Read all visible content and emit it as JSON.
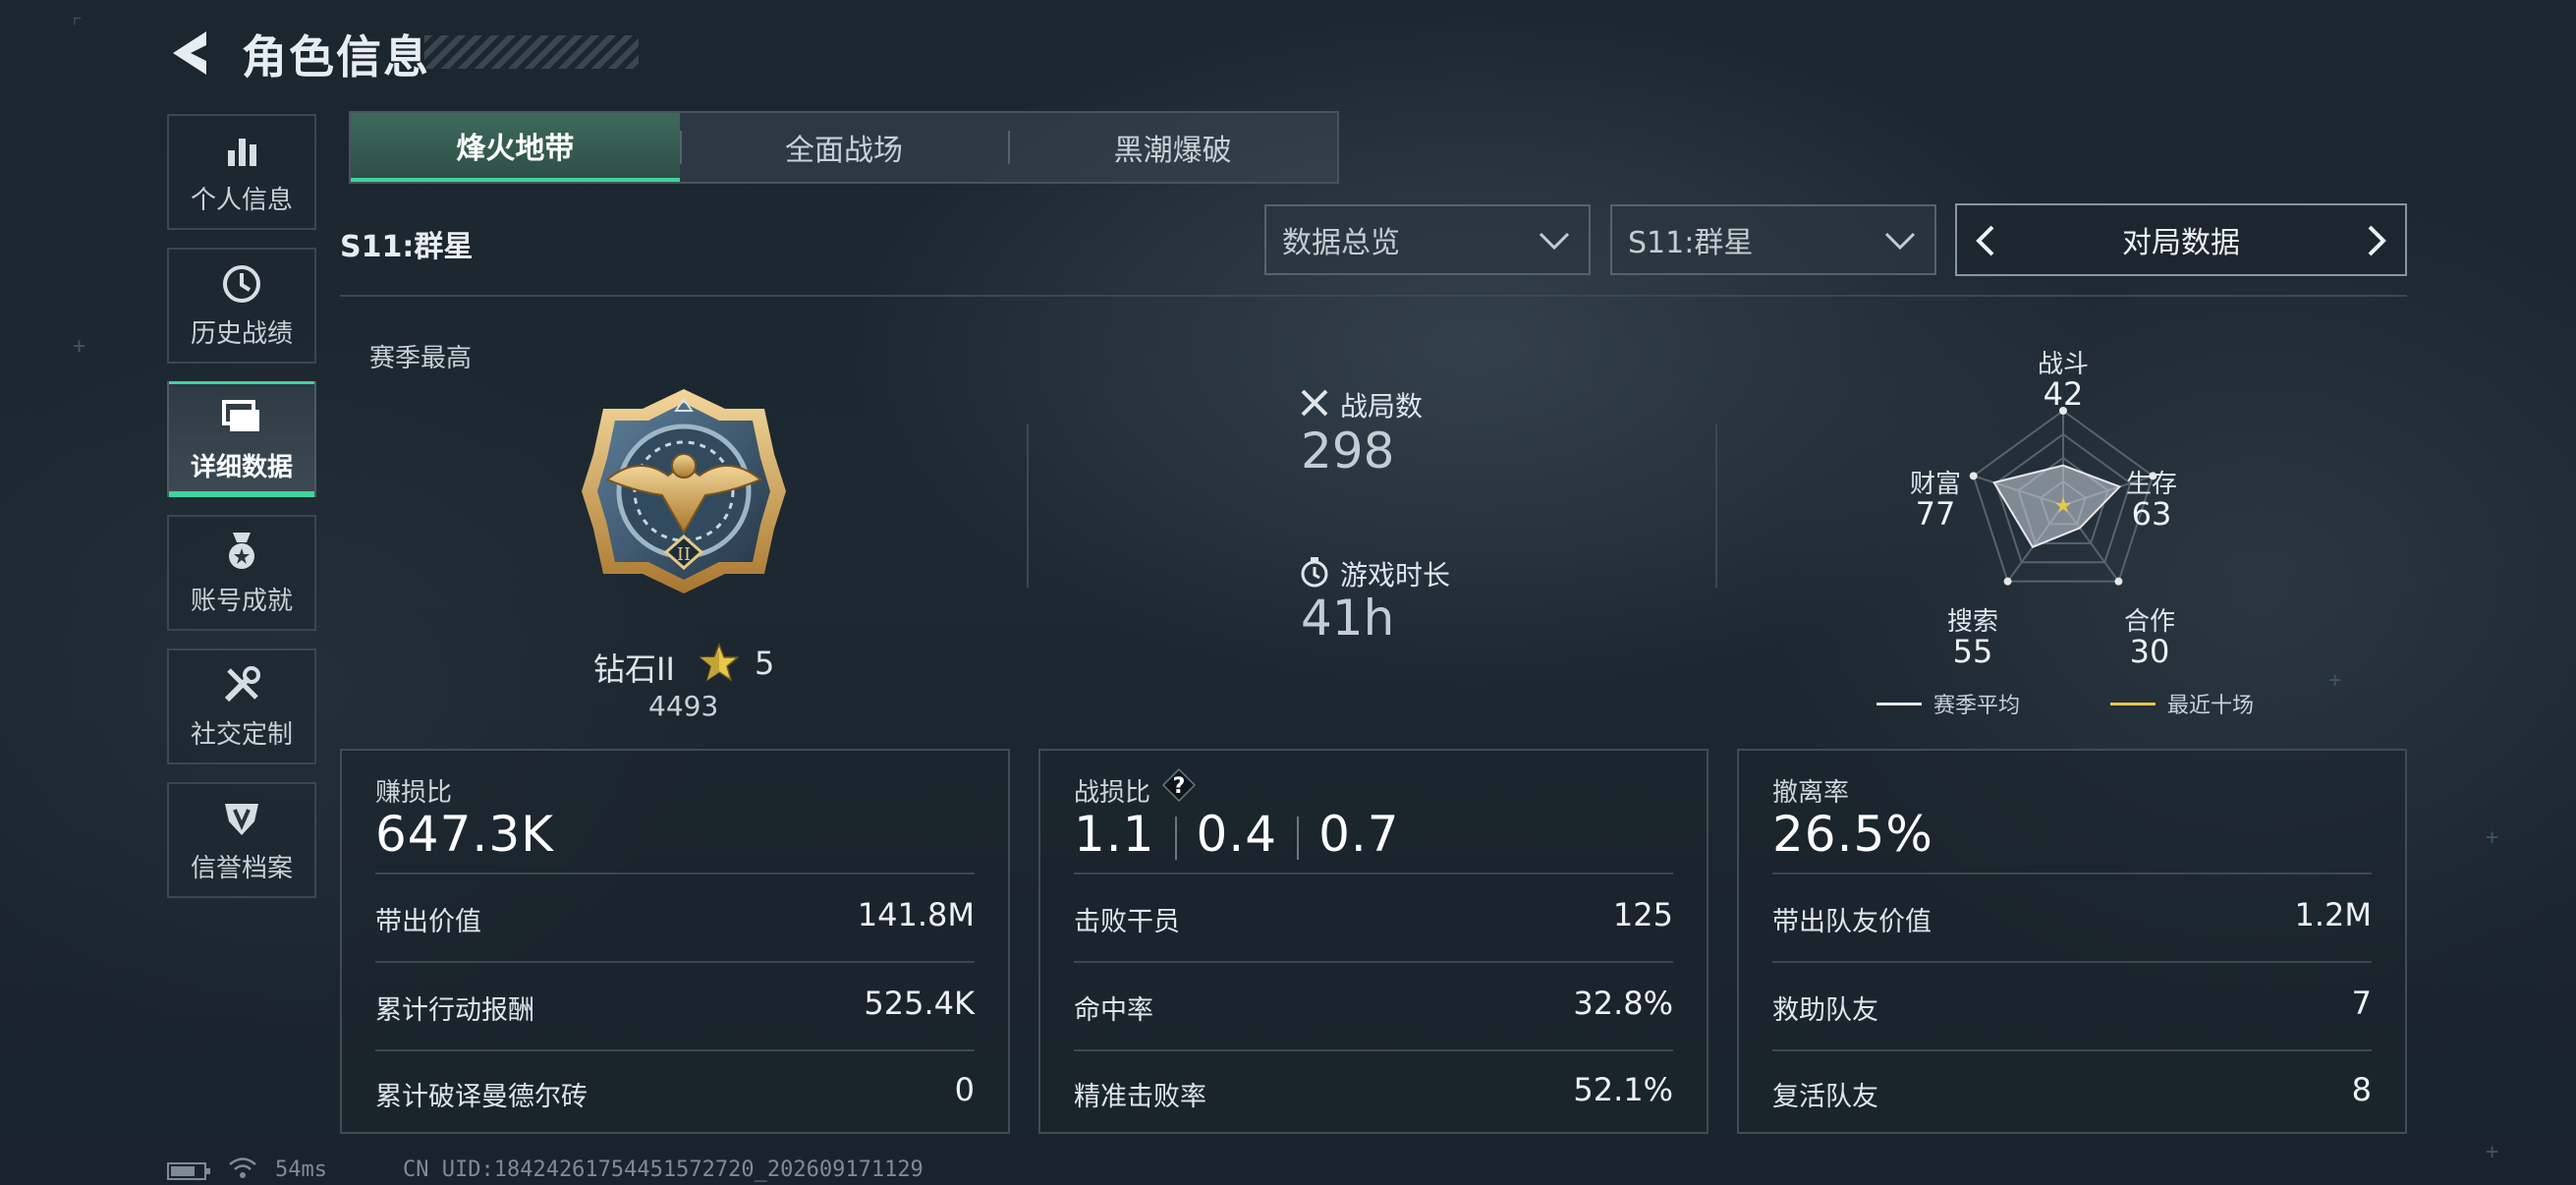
{
  "header": {
    "title": "角色信息"
  },
  "sidebar": {
    "items": [
      {
        "label": "个人信息",
        "icon": "bar-chart-icon"
      },
      {
        "label": "历史战绩",
        "icon": "clock-icon"
      },
      {
        "label": "详细数据",
        "icon": "folder-icon",
        "active": true
      },
      {
        "label": "账号成就",
        "icon": "medal-icon"
      },
      {
        "label": "社交定制",
        "icon": "tools-icon"
      },
      {
        "label": "信誉档案",
        "icon": "shield-badge-icon"
      }
    ]
  },
  "mode_tabs": [
    {
      "label": "烽火地带",
      "active": true
    },
    {
      "label": "全面战场"
    },
    {
      "label": "黑潮爆破"
    }
  ],
  "season_title": "S11:群星",
  "filters": {
    "view_select": "数据总览",
    "season_select": "S11:群星",
    "pager_label": "对局数据"
  },
  "rank": {
    "label": "赛季最高",
    "name": "钻石II",
    "stars": "5",
    "score": "4493",
    "medal_numeral": "II"
  },
  "summary": {
    "matches_label": "战局数",
    "matches_value": "298",
    "playtime_label": "游戏时长",
    "playtime_value": "41h"
  },
  "radar": {
    "labels": {
      "combat": "战斗",
      "combat_value": "42",
      "survival": "生存",
      "survival_value": "63",
      "teamwork": "合作",
      "teamwork_value": "30",
      "search": "搜索",
      "search_value": "55",
      "wealth": "财富",
      "wealth_value": "77"
    },
    "values": [
      42,
      63,
      30,
      55,
      77
    ],
    "legend": [
      {
        "label": "赛季平均",
        "color": "#e8e8e8"
      },
      {
        "label": "最近十场",
        "color": "#e8c84a"
      }
    ]
  },
  "panels": {
    "profit": {
      "title": "赚损比",
      "big": "647.3K",
      "rows": [
        {
          "label": "带出价值",
          "value": "141.8M"
        },
        {
          "label": "累计行动报酬",
          "value": "525.4K"
        },
        {
          "label": "累计破译曼德尔砖",
          "value": "0"
        }
      ]
    },
    "combat": {
      "title": "战损比",
      "help": "?",
      "kd_values": [
        "1.1",
        "0.4",
        "0.7"
      ],
      "rows": [
        {
          "label": "击败干员",
          "value": "125"
        },
        {
          "label": "命中率",
          "value": "32.8%"
        },
        {
          "label": "精准击败率",
          "value": "52.1%"
        }
      ]
    },
    "extract": {
      "title": "撤离率",
      "big": "26.5%",
      "rows": [
        {
          "label": "带出队友价值",
          "value": "1.2M"
        },
        {
          "label": "救助队友",
          "value": "7"
        },
        {
          "label": "复活队友",
          "value": "8"
        }
      ]
    }
  },
  "footer": {
    "ping": "54ms",
    "uid": "CN UID:18424261754451572720_202609171129"
  },
  "colors": {
    "accent": "#3fd49a",
    "gold": "#e8c84a"
  }
}
